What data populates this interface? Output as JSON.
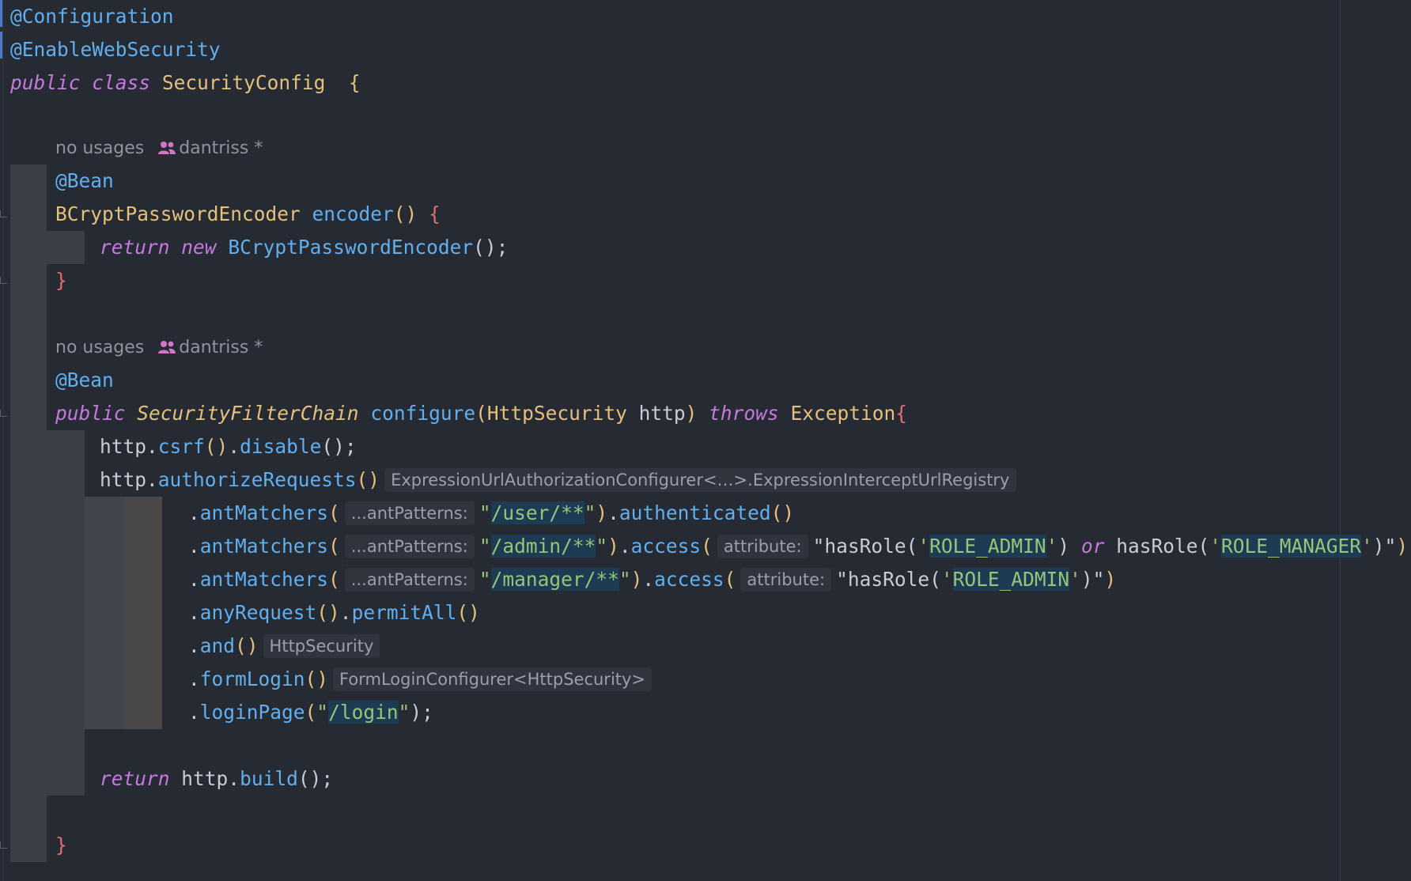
{
  "lines": {
    "l1": {
      "annotation": "@Configuration"
    },
    "l2": {
      "annotation": "@EnableWebSecurity"
    },
    "l3": {
      "kw_public": "public",
      "kw_class": "class",
      "class_name": "SecurityConfig",
      "brace": "{"
    },
    "lens1": {
      "usages": "no usages",
      "author": "dantriss",
      "marker": "*"
    },
    "l5": {
      "annotation": "@Bean"
    },
    "l6": {
      "type": "BCryptPasswordEncoder",
      "method": "encoder",
      "parens": "()",
      "brace": "{"
    },
    "l7": {
      "kw_return": "return",
      "kw_new": "new",
      "ctor": "BCryptPasswordEncoder",
      "tail": "();"
    },
    "l8": {
      "brace": "}"
    },
    "lens2": {
      "usages": "no usages",
      "author": "dantriss",
      "marker": "*"
    },
    "l10": {
      "annotation": "@Bean"
    },
    "l11": {
      "kw_public": "public",
      "type": "SecurityFilterChain",
      "method": "configure",
      "open": "(",
      "param_type": "HttpSecurity",
      "param": "http",
      "close": ")",
      "kw_throws": "throws",
      "exception": "Exception",
      "brace": "{"
    },
    "l12": {
      "obj": "http",
      "dot1": ".",
      "m1": "csrf",
      "p1": "()",
      "dot2": ".",
      "m2": "disable",
      "tail": "();"
    },
    "l13": {
      "obj": "http",
      "dot": ".",
      "method": "authorizeRequests",
      "parens": "()",
      "hint": "ExpressionUrlAuthorizationConfigurer<…>.ExpressionInterceptUrlRegistry"
    },
    "l14": {
      "dot": ".",
      "method": "antMatchers",
      "open": "(",
      "hint": "...antPatterns:",
      "q1": "\"",
      "path": "/user/**",
      "q2": "\"",
      "close": ")",
      "dot2": ".",
      "m2": "authenticated",
      "p2": "()"
    },
    "l15": {
      "dot": ".",
      "method": "antMatchers",
      "open": "(",
      "hint": "...antPatterns:",
      "q1": "\"",
      "path": "/admin/**",
      "q2": "\"",
      "close": ")",
      "dot2": ".",
      "m2": "access",
      "open2": "(",
      "hint2": "attribute:",
      "s1": "\"hasRole(",
      "q3": "'",
      "role1": "ROLE_ADMIN",
      "q4": "'",
      "s2": ")",
      "kw_or": "or",
      "s3": "hasRole(",
      "q5": "'",
      "role2": "ROLE_MANAGER",
      "q6": "'",
      "s4": ")\"",
      "close2": ")"
    },
    "l16": {
      "dot": ".",
      "method": "antMatchers",
      "open": "(",
      "hint": "...antPatterns:",
      "q1": "\"",
      "path": "/manager/**",
      "q2": "\"",
      "close": ")",
      "dot2": ".",
      "m2": "access",
      "open2": "(",
      "hint2": "attribute:",
      "s1": "\"hasRole(",
      "q3": "'",
      "role1": "ROLE_ADMIN",
      "q4": "'",
      "s2": ")\"",
      "close2": ")"
    },
    "l17": {
      "dot": ".",
      "m1": "anyRequest",
      "p1": "()",
      "dot2": ".",
      "m2": "permitAll",
      "p2": "()"
    },
    "l18": {
      "dot": ".",
      "method": "and",
      "parens": "()",
      "hint": "HttpSecurity"
    },
    "l19": {
      "dot": ".",
      "method": "formLogin",
      "parens": "()",
      "hint": "FormLoginConfigurer<HttpSecurity>"
    },
    "l20": {
      "dot": ".",
      "method": "loginPage",
      "open": "(",
      "q1": "\"",
      "path": "/login",
      "q2": "\"",
      "tail": ");"
    },
    "l22": {
      "kw_return": "return",
      "obj": "http",
      "dot": ".",
      "method": "build",
      "tail": "();"
    },
    "l24": {
      "brace": "}"
    }
  },
  "colors": {
    "background": "#262a33",
    "keyword": "#c678dd",
    "type": "#e5c07b",
    "function": "#61afef",
    "string": "#98c379",
    "brace": "#e06c75",
    "highlight": "#1d3b53"
  },
  "icons": {
    "author": "user-group-icon"
  }
}
